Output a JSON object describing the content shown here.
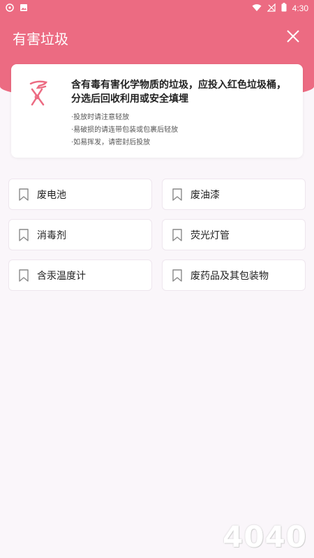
{
  "status_bar": {
    "time": "4:30",
    "icons": [
      "app-icon",
      "image-icon",
      "wifi-icon",
      "signal-icon",
      "battery-icon"
    ]
  },
  "header": {
    "title": "有害垃圾",
    "close_icon": "close-icon",
    "color": "#ec6b82"
  },
  "info": {
    "icon": "hazard-icon",
    "description": "含有毒有害化学物质的垃圾，应投入红色垃圾桶，分选后回收利用或安全填埋",
    "tips": [
      "·投放时请注意轻放",
      "·易破损的请连带包装或包裹后轻放",
      "·如易挥发，请密封后投放"
    ]
  },
  "items": [
    {
      "label": "废电池"
    },
    {
      "label": "废油漆"
    },
    {
      "label": "消毒剂"
    },
    {
      "label": "荧光灯管"
    },
    {
      "label": "含汞温度计"
    },
    {
      "label": "废药品及其包装物"
    }
  ],
  "watermark": "4040"
}
